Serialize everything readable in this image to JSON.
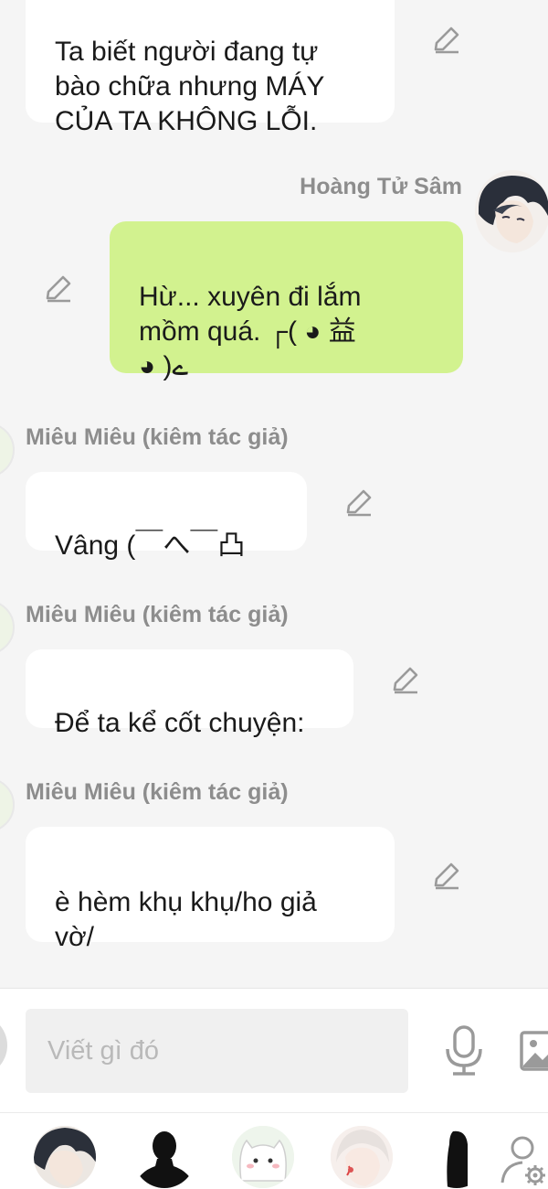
{
  "messages": [
    {
      "sender": "",
      "side": "left",
      "text": "Ta biết người đang tự\nbào chữa nhưng MÁY\nCỦA TA KHÔNG LỖI."
    },
    {
      "sender": "Hoàng Tử Sâm",
      "side": "right",
      "text": "Hừ... xuyên đi lắm\nmồm quá. ┌( ◕ 益\n◕ )ے"
    },
    {
      "sender": "Miêu Miêu (kiêm tác giả)",
      "side": "left",
      "text": "Vâng (￣へ￣凸"
    },
    {
      "sender": "Miêu Miêu (kiêm tác giả)",
      "side": "left",
      "text": "Để ta kể cốt chuyện:"
    },
    {
      "sender": "Miêu Miêu (kiêm tác giả)",
      "side": "left",
      "text": "è hèm khụ khụ/ho giả\nvờ/"
    }
  ],
  "composer": {
    "placeholder": "Viết gì đó",
    "mic_icon": "microphone-icon",
    "image_icon": "image-icon"
  },
  "characters": [
    {
      "name": "dark-haired-boy-avatar"
    },
    {
      "name": "silhouette-man-avatar"
    },
    {
      "name": "white-cat-avatar"
    },
    {
      "name": "white-haired-boy-avatar"
    },
    {
      "name": "silhouette-woman-avatar"
    }
  ],
  "colors": {
    "background": "#f5f5f5",
    "bubble_left": "#ffffff",
    "bubble_right": "#d2f28f",
    "sender_text": "#8d8d8d",
    "icon": "#9a9a9a"
  }
}
